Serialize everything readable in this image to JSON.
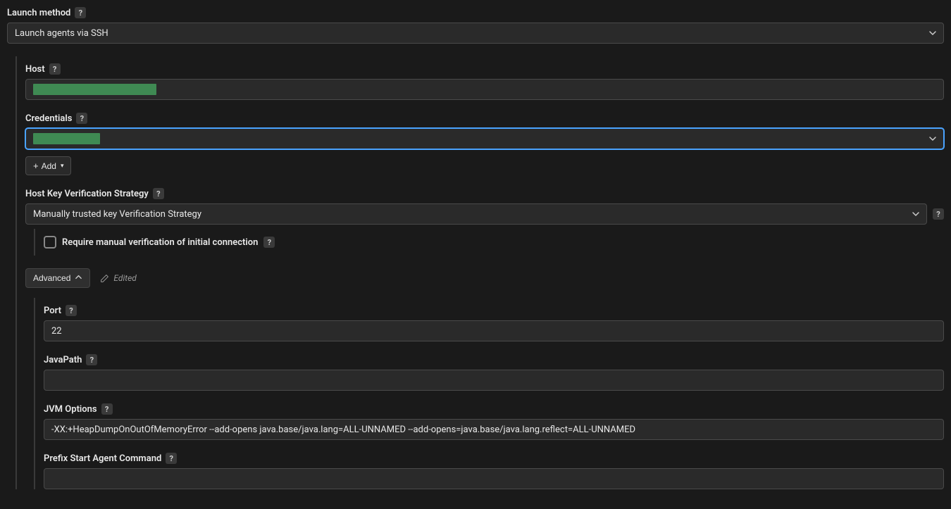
{
  "launchMethod": {
    "label": "Launch method",
    "value": "Launch agents via SSH"
  },
  "host": {
    "label": "Host",
    "value": ""
  },
  "credentials": {
    "label": "Credentials",
    "value": ""
  },
  "addButton": {
    "label": "Add"
  },
  "hostKey": {
    "label": "Host Key Verification Strategy",
    "value": "Manually trusted key Verification Strategy"
  },
  "requireManual": {
    "label": "Require manual verification of initial connection",
    "checked": false
  },
  "advanced": {
    "label": "Advanced",
    "edited": "Edited"
  },
  "port": {
    "label": "Port",
    "value": "22"
  },
  "javaPath": {
    "label": "JavaPath",
    "value": ""
  },
  "jvmOptions": {
    "label": "JVM Options",
    "value": "-XX:+HeapDumpOnOutOfMemoryError --add-opens java.base/java.lang=ALL-UNNAMED --add-opens=java.base/java.lang.reflect=ALL-UNNAMED"
  },
  "prefixStart": {
    "label": "Prefix Start Agent Command",
    "value": ""
  }
}
